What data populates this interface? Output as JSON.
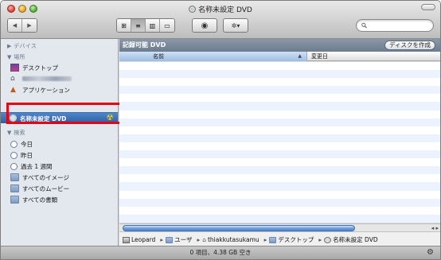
{
  "window": {
    "title": "名称未設定 DVD"
  },
  "toolbar": {
    "nav_back": "◀",
    "nav_forward": "▶",
    "view_icons": "⊞",
    "view_list": "≡",
    "view_columns": "▥",
    "view_coverflow": "▭",
    "quicklook": "◉",
    "action": "✲▾",
    "search_value": "",
    "search_placeholder": ""
  },
  "sidebar": {
    "devices_header": "▶ デバイス",
    "places_header": "▼ 場所",
    "places": [
      {
        "label": "デスクトップ",
        "icon": "desktop-icon"
      },
      {
        "label": "",
        "icon": "home-icon"
      },
      {
        "label": "アプリケーション",
        "icon": "applications-icon"
      }
    ],
    "selected_item": "名称未設定 DVD",
    "search_header": "▼ 検索",
    "search_items": [
      {
        "label": "今日",
        "icon": "clock-icon"
      },
      {
        "label": "昨日",
        "icon": "clock-icon"
      },
      {
        "label": "過去 1 週間",
        "icon": "clock-icon"
      },
      {
        "label": "すべてのイメージ",
        "icon": "folder-icon"
      },
      {
        "label": "すべてのムービー",
        "icon": "folder-icon"
      },
      {
        "label": "すべての書類",
        "icon": "folder-icon"
      }
    ]
  },
  "main": {
    "burn_header": "記録可能 DVD",
    "burn_button": "ディスクを作成",
    "col_name": "名前",
    "col_date": "変更日",
    "sort_indicator": "▲"
  },
  "pathbar": {
    "items": [
      "Leopard",
      "ユーザ",
      "thiakkutasukamu",
      "デスクトップ",
      "名称未設定 DVD"
    ]
  },
  "status": {
    "text": "0 項目、4.38 GB 空き"
  },
  "colors": {
    "selection": "#2a5fa6",
    "highlight_box": "#e60012",
    "stripe": "#ecf3fe"
  }
}
